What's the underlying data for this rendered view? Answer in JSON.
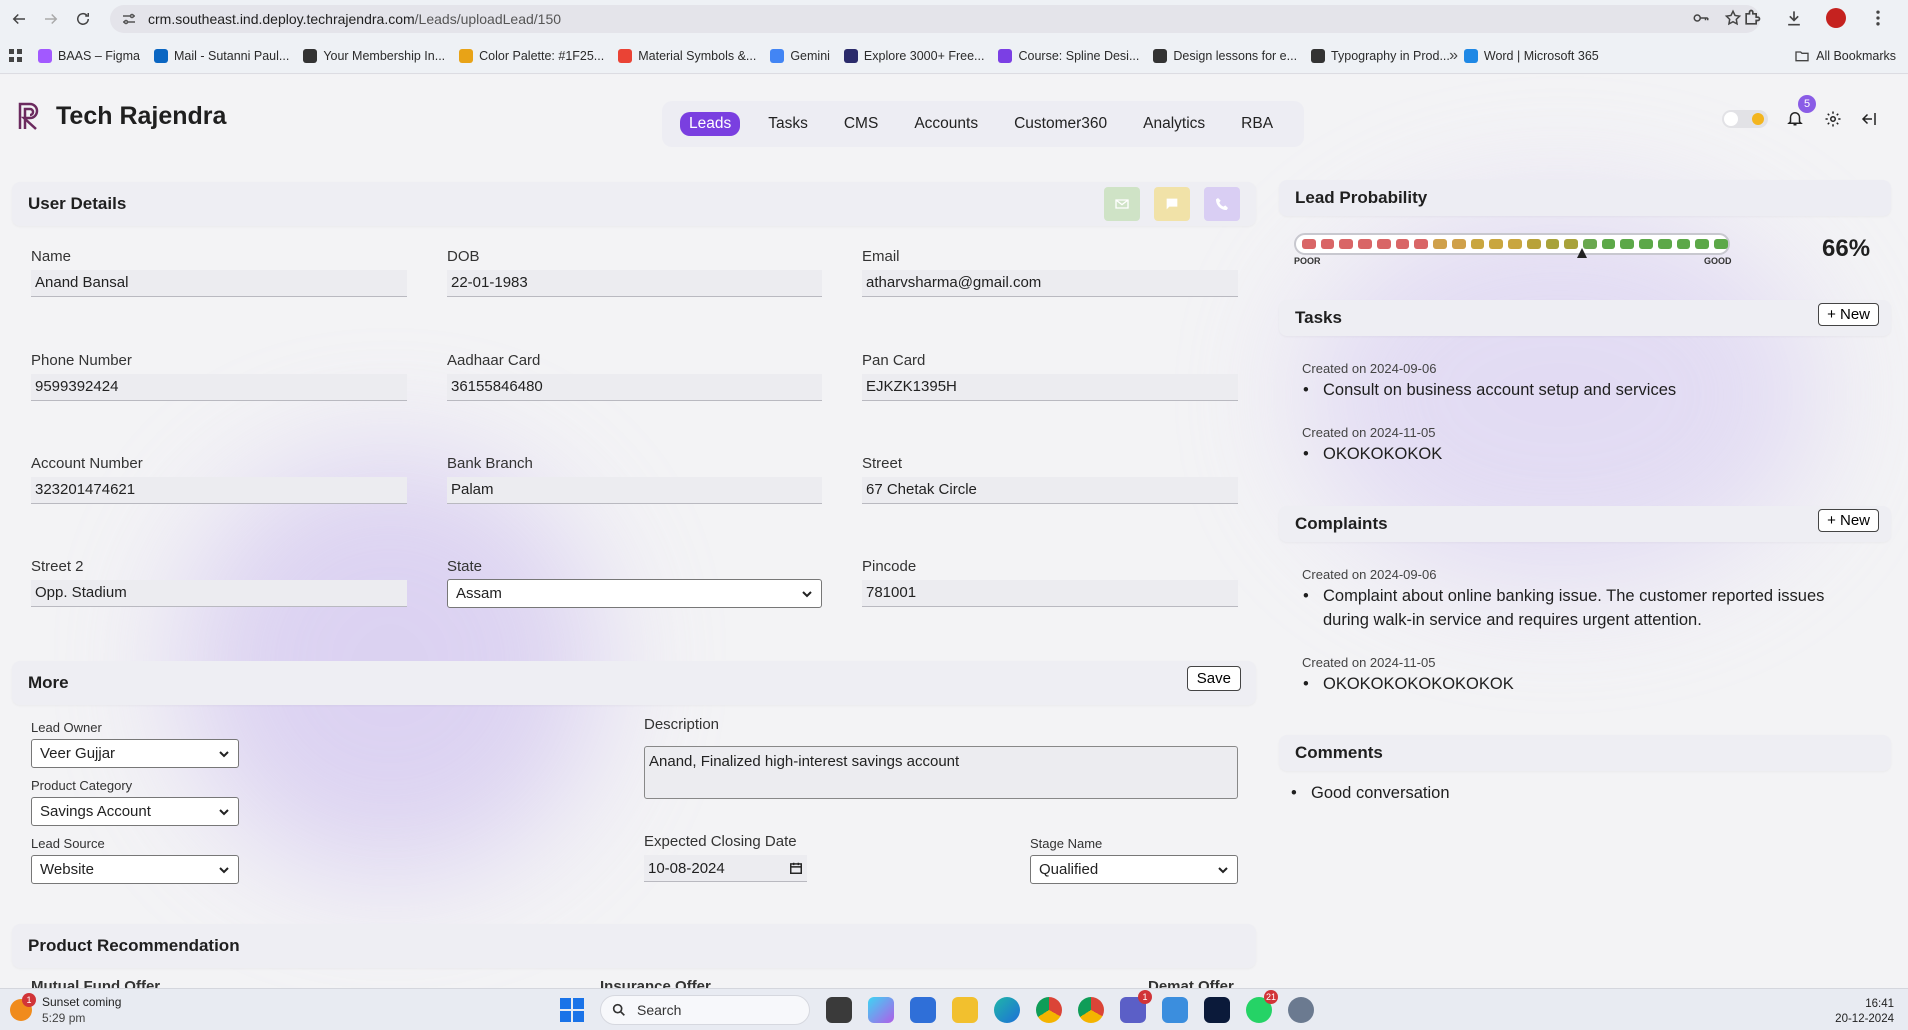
{
  "browser": {
    "url_host": "crm.southeast.ind.deploy.techrajendra.com",
    "url_path": "/Leads/uploadLead/150",
    "bookmarks": [
      {
        "label": "BAAS – Figma",
        "color": "#a259ff"
      },
      {
        "label": "Mail - Sutanni Paul...",
        "color": "#0a66c2"
      },
      {
        "label": "Your Membership In...",
        "color": "#333333"
      },
      {
        "label": "Color Palette: #1F25...",
        "color": "#e8a317"
      },
      {
        "label": "Material Symbols &...",
        "color": "#ea4335"
      },
      {
        "label": "Gemini",
        "color": "#4285f4"
      },
      {
        "label": "Explore 3000+ Free...",
        "color": "#2b2b6b"
      },
      {
        "label": "Course: Spline Desi...",
        "color": "#7b3fe4"
      },
      {
        "label": "Design lessons for e...",
        "color": "#333333"
      },
      {
        "label": "Typography in Prod...",
        "color": "#333333"
      },
      {
        "label": "Word | Microsoft 365",
        "color": "#1e88e5"
      }
    ],
    "all_bookmarks": "All Bookmarks"
  },
  "app": {
    "brand": "Tech Rajendra",
    "accent": "#7a3fe0",
    "nav": [
      "Leads",
      "Tasks",
      "CMS",
      "Accounts",
      "Customer360",
      "Analytics",
      "RBA"
    ],
    "active_nav": "Leads",
    "notification_count": "5"
  },
  "user_details": {
    "title": "User Details",
    "fields": {
      "name": {
        "label": "Name",
        "value": "Anand Bansal"
      },
      "dob": {
        "label": "DOB",
        "value": "22-01-1983"
      },
      "email": {
        "label": "Email",
        "value": "atharvsharma@gmail.com"
      },
      "phone": {
        "label": "Phone Number",
        "value": "9599392424"
      },
      "aadhaar": {
        "label": "Aadhaar Card",
        "value": "36155846480"
      },
      "pan": {
        "label": "Pan Card",
        "value": "EJKZK1395H"
      },
      "account": {
        "label": "Account Number",
        "value": "323201474621"
      },
      "branch": {
        "label": "Bank Branch",
        "value": "Palam"
      },
      "street": {
        "label": "Street",
        "value": "67 Chetak Circle"
      },
      "street2": {
        "label": "Street 2",
        "value": "Opp. Stadium"
      },
      "state": {
        "label": "State",
        "value": "Assam"
      },
      "pincode": {
        "label": "Pincode",
        "value": "781001"
      }
    }
  },
  "more": {
    "title": "More",
    "save_label": "Save",
    "lead_owner": {
      "label": "Lead Owner",
      "value": "Veer Gujjar"
    },
    "product_category": {
      "label": "Product Category",
      "value": "Savings Account"
    },
    "lead_source": {
      "label": "Lead Source",
      "value": "Website"
    },
    "description": {
      "label": "Description",
      "value": "Anand, Finalized high-interest savings account"
    },
    "closing_date": {
      "label": "Expected Closing Date",
      "value": "10-08-2024"
    },
    "stage": {
      "label": "Stage Name",
      "value": "Qualified"
    }
  },
  "product_recommendation": {
    "title": "Product Recommendation",
    "columns": [
      "Mutual Fund Offer",
      "Insurance Offer",
      "Demat Offer"
    ]
  },
  "lead_probability": {
    "title": "Lead Probability",
    "value": "66%",
    "fraction": 0.66,
    "poor_label": "POOR",
    "good_label": "GOOD",
    "segments": [
      "#d96566",
      "#d96566",
      "#d96566",
      "#d96566",
      "#d96566",
      "#d96566",
      "#d96566",
      "#cfa04a",
      "#cfa04a",
      "#c9a63f",
      "#c9a63f",
      "#c9a63f",
      "#b8a23a",
      "#a8a23a",
      "#a8a23a",
      "#6aa84f",
      "#5ca848",
      "#5ca848",
      "#5ca848",
      "#5ca848",
      "#5ca848",
      "#5ca848",
      "#5ca848"
    ]
  },
  "tasks": {
    "title": "Tasks",
    "new_label": "+ New",
    "items": [
      {
        "created": "Created on 2024-09-06",
        "text": "Consult on business account setup and services"
      },
      {
        "created": "Created on 2024-11-05",
        "text": "OKOKOKOKOK"
      }
    ]
  },
  "complaints": {
    "title": "Complaints",
    "new_label": "+ New",
    "items": [
      {
        "created": "Created on 2024-09-06",
        "text": "Complaint about online banking issue. The customer reported issues during walk-in service and requires urgent attention."
      },
      {
        "created": "Created on 2024-11-05",
        "text": "OKOKOKOKOKOKOKOK"
      }
    ]
  },
  "comments": {
    "title": "Comments",
    "items": [
      "Good conversation"
    ]
  },
  "taskbar": {
    "weather_title": "Sunset coming",
    "weather_time": "5:29 pm",
    "weather_badge": "1",
    "search_placeholder": "Search",
    "teams_badge": "1",
    "whatsapp_badge": "21",
    "time": "16:41",
    "date": "20-12-2024"
  }
}
